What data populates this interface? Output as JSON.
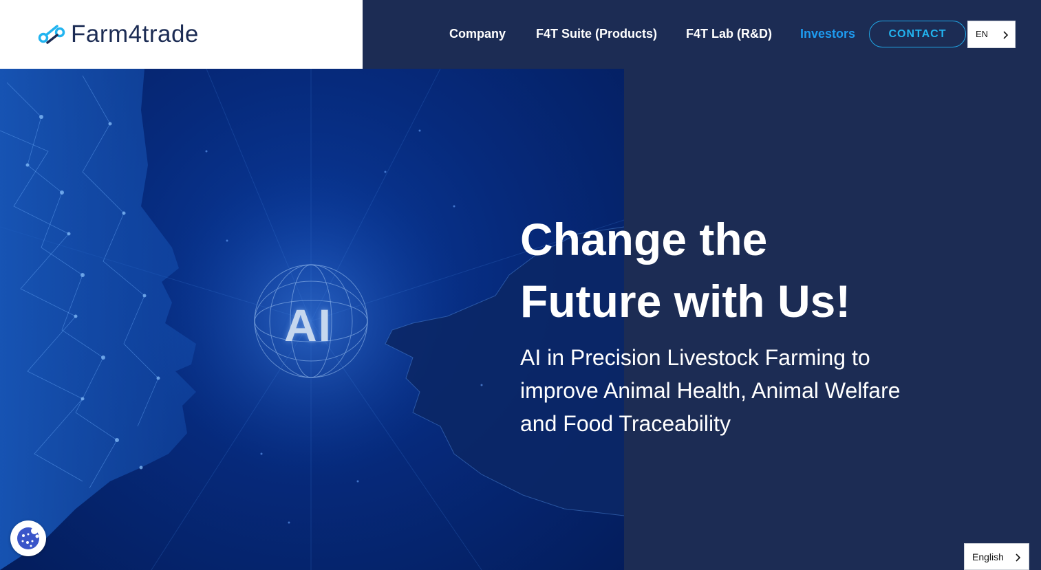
{
  "brand": {
    "name": "Farm4trade",
    "accent_color": "#20a9e8",
    "navy_color": "#1c2c54"
  },
  "nav": {
    "items": [
      {
        "label": "Company"
      },
      {
        "label": "F4T Suite (Products)"
      },
      {
        "label": "F4T Lab (R&D)"
      },
      {
        "label": "Investors",
        "active": true
      }
    ],
    "contact_label": "CONTACT",
    "language_code": "EN"
  },
  "hero": {
    "image_text": "AI",
    "title_line1": "Change the",
    "title_line2": "Future with Us!",
    "subtitle": "AI in Precision Livestock Farming to improve Animal Health, Animal Welfare and Food Traceability"
  },
  "widgets": {
    "cookie_icon": "cookie-icon",
    "language_select_value": "English"
  }
}
